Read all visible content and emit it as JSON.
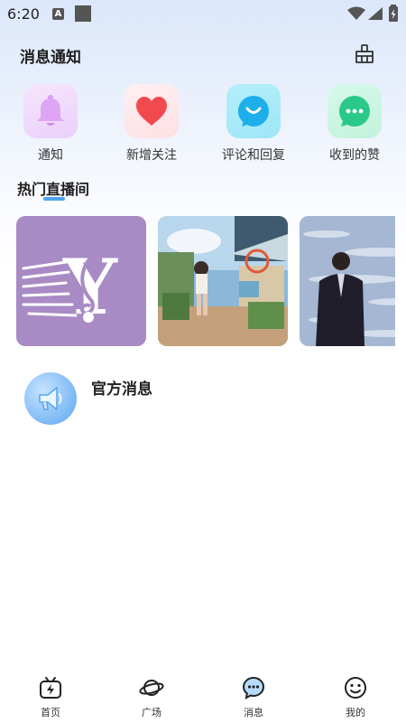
{
  "status_bar": {
    "time": "6:20",
    "notif_letter": "A"
  },
  "header": {
    "title": "消息通知"
  },
  "quick_actions": [
    {
      "label": "通知",
      "icon": "bell-icon",
      "tile_color": "#f3e0fb"
    },
    {
      "label": "新增关注",
      "icon": "heart-icon",
      "tile_color": "#fde7ea"
    },
    {
      "label": "评论和回复",
      "icon": "comment-icon",
      "tile_color": "#bff1fb"
    },
    {
      "label": "收到的赞",
      "icon": "message-dots-icon",
      "tile_color": "#cdf6e4"
    }
  ],
  "live_section": {
    "title": "热门直播间",
    "cards": [
      {
        "name": "music-logo-card",
        "logo_letter": "Y"
      },
      {
        "name": "anime-street-card"
      },
      {
        "name": "man-by-sea-card"
      }
    ]
  },
  "official": {
    "name": "官方消息",
    "icon": "megaphone-icon"
  },
  "bottom_nav": [
    {
      "label": "首页",
      "icon": "tv-icon"
    },
    {
      "label": "广场",
      "icon": "planet-icon"
    },
    {
      "label": "消息",
      "icon": "chat-bubble-icon",
      "active": true
    },
    {
      "label": "我的",
      "icon": "smiley-icon"
    }
  ],
  "colors": {
    "accent": "#4ea2ef",
    "logo_card_bg": "#a88bc4"
  }
}
